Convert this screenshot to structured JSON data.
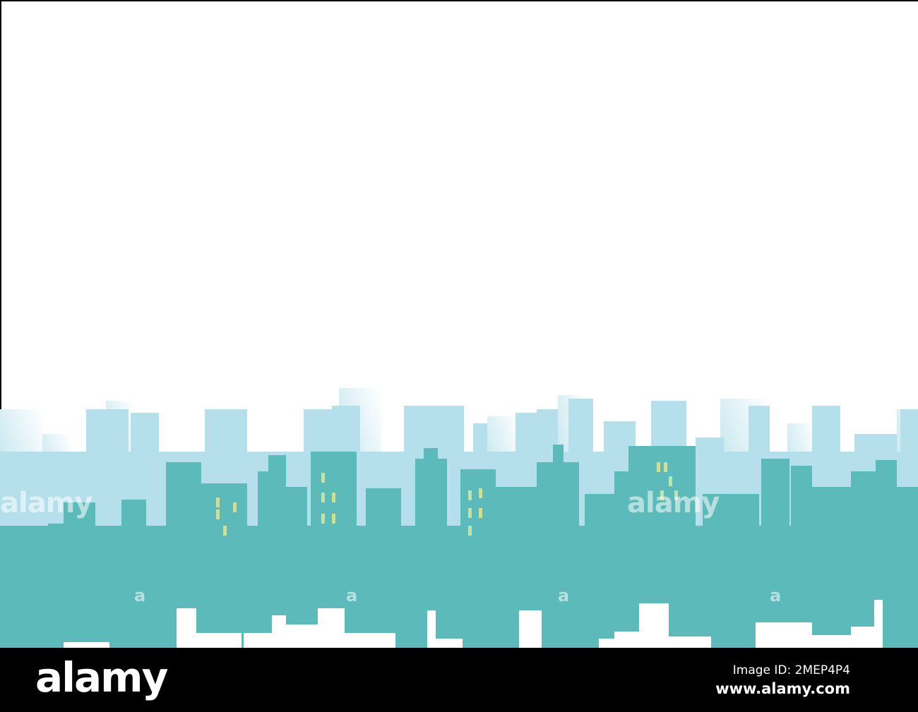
{
  "colors": {
    "sky_building": "#b5dfea",
    "front_building": "#5dbaba",
    "window": "#c9e0a0",
    "footer": "#000000"
  },
  "footer": {
    "logo": "alamy",
    "image_id": "Image ID: 2MEP4P4",
    "url": "www.alamy.com"
  },
  "watermark": {
    "text": "alamy",
    "mark": "a"
  }
}
